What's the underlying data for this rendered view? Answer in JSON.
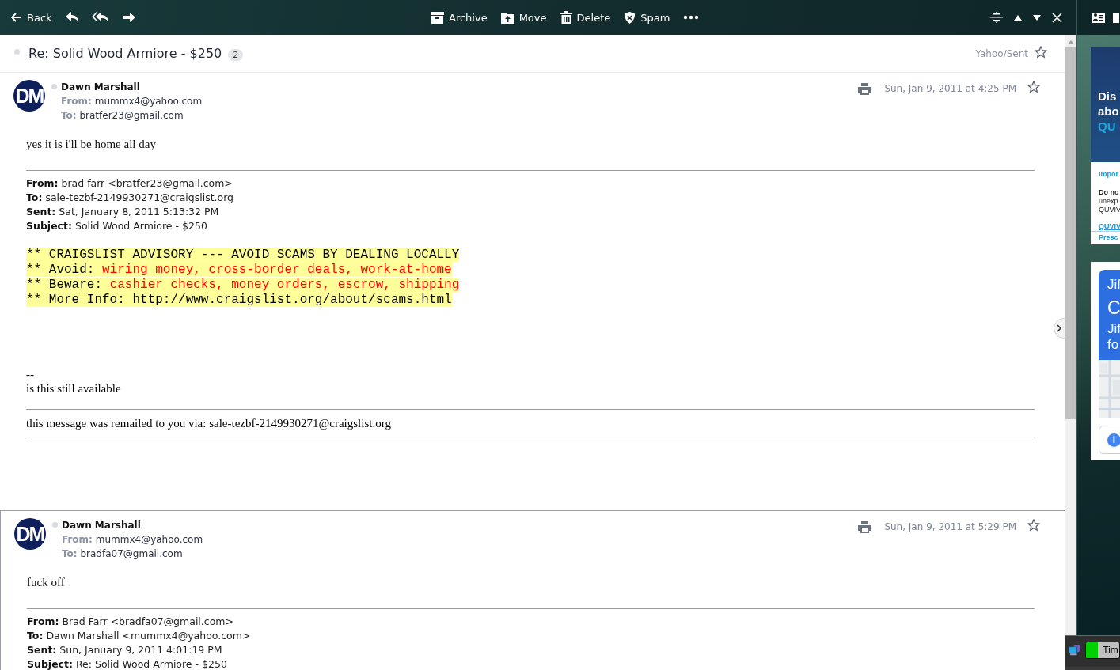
{
  "toolbar": {
    "nav": [
      {
        "kind": "back",
        "label": "Back"
      },
      {
        "kind": "reply"
      },
      {
        "kind": "reply-all"
      },
      {
        "kind": "forward"
      }
    ],
    "actions": [
      {
        "kind": "archive",
        "label": "Archive"
      },
      {
        "kind": "move",
        "label": "Move"
      },
      {
        "kind": "delete",
        "label": "Delete"
      },
      {
        "kind": "spam",
        "label": "Spam"
      },
      {
        "kind": "more"
      }
    ]
  },
  "thread": {
    "subject": "Re: Solid Wood Armiore - $250",
    "count": "2",
    "folder": "Yahoo/Sent",
    "starred": false
  },
  "messages": [
    {
      "sender": "Dawn Marshall",
      "initials": "DM",
      "from": "**From:** mummx4@yahoo.com",
      "to": "**To:** bratfer23@gmail.com",
      "date": "Sun, Jan 9, 2011 at 4:25 PM",
      "starred": false,
      "body": "yes it is i'll be home all day",
      "quoted_headers": [
        "**From:** brad farr <bratfer23@gmail.com>",
        "**To:** sale-tezbf-2149930271@craigslist.org",
        "**Sent:** Sat, January 8, 2011 5:13:32 PM",
        "**Subject:** Solid Wood Armiore - $250"
      ],
      "advisory": [
        {
          "text": "** CRAIGSLIST ADVISORY --- AVOID SCAMS BY DEALING LOCALLY"
        },
        {
          "text": "** Avoid: ",
          "warning": "wiring money, cross-border deals, work-at-home"
        },
        {
          "text": "** Beware: ",
          "warning": "cashier checks, money orders, escrow, shipping"
        },
        {
          "text": "** More Info: http://www.craigslist.org/about/scams.html"
        }
      ],
      "quoted_lines": [
        "--",
        "is this still available"
      ],
      "footer": "this message was remailed to you via: sale-tezbf-2149930271@craigslist.org"
    },
    {
      "sender": "Dawn Marshall",
      "initials": "DM",
      "from": "**From:** mummx4@yahoo.com",
      "to": "**To:** bradfa07@gmail.com",
      "date": "Sun, Jan 9, 2011 at 5:29 PM",
      "starred": false,
      "body": "fuck off",
      "quoted_headers": [
        "**From:** Brad Farr <bradfa07@gmail.com>",
        "**To:** Dawn Marshall <mummx4@yahoo.com>",
        "**Sent:** Sun, January 9, 2011 4:01:19 PM",
        "**Subject:** Re: Solid Wood Armiore - $250"
      ]
    }
  ],
  "ad_panel": {
    "cards": [
      {
        "kind": "text-ad",
        "headline": [
          "Dis",
          "abo"
        ],
        "highlight": "QU",
        "subtitle": "Impor",
        "lead": "Do nc",
        "body": [
          "unexp",
          "QUVIV"
        ],
        "link": "QUVIV",
        "footer": "Presc"
      },
      {
        "kind": "map-ad",
        "headline": "Jif",
        "big": "C",
        "lines": [
          "Jif",
          "fo"
        ],
        "button": "i"
      }
    ]
  },
  "tray": {
    "label": "Tim",
    "level": 0.35
  }
}
